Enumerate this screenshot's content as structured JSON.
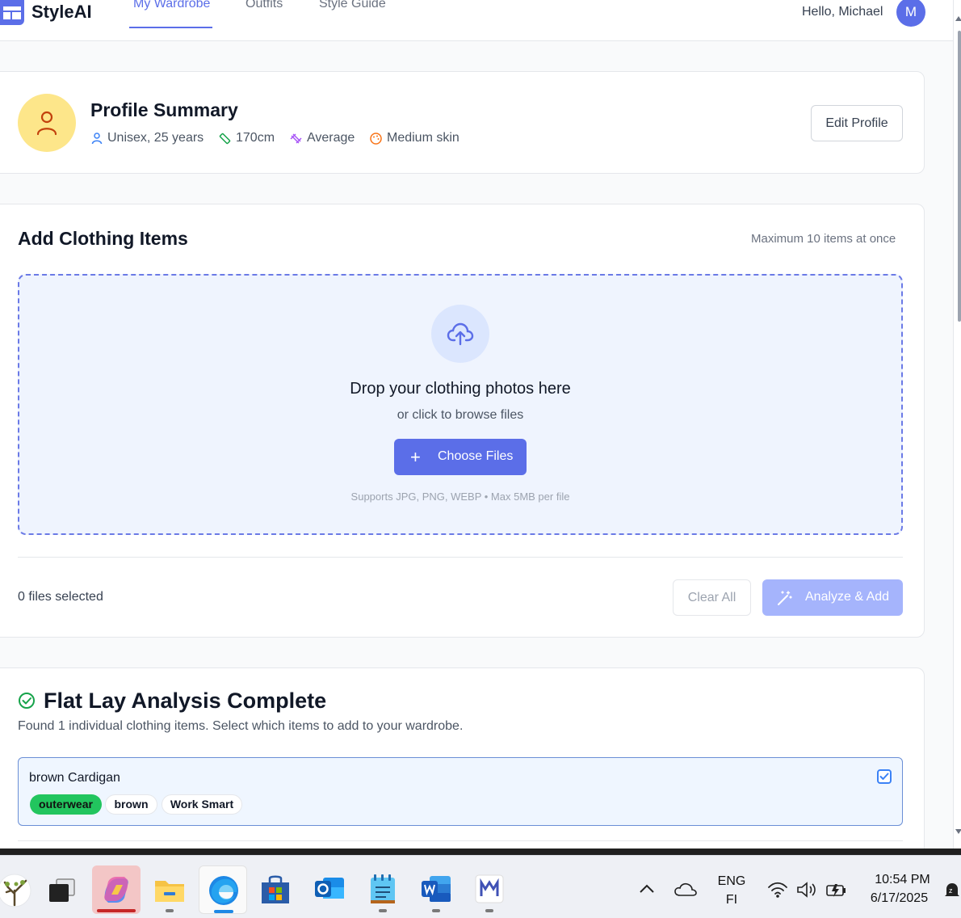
{
  "header": {
    "brand": "StyleAI",
    "tabs": [
      {
        "label": "My Wardrobe",
        "active": true
      },
      {
        "label": "Outfits",
        "active": false
      },
      {
        "label": "Style Guide",
        "active": false
      }
    ],
    "greeting": "Hello, Michael",
    "avatar_initial": "M"
  },
  "profile": {
    "title": "Profile Summary",
    "gender_age": "Unisex, 25 years",
    "height": "170cm",
    "build": "Average",
    "skin": "Medium skin",
    "edit_label": "Edit Profile"
  },
  "add_items": {
    "title": "Add Clothing Items",
    "max_note": "Maximum 10 items at once",
    "drop_title": "Drop your clothing photos here",
    "drop_sub": "or click to browse files",
    "choose_label": "Choose Files",
    "supports": "Supports JPG, PNG, WEBP • Max 5MB per file",
    "files_selected": "0 files selected",
    "clear_label": "Clear All",
    "analyze_label": "Analyze & Add"
  },
  "analysis": {
    "title": "Flat Lay Analysis Complete",
    "subtitle": "Found 1 individual clothing items. Select which items to add to your wardrobe.",
    "items": [
      {
        "name": "brown Cardigan",
        "selected": true,
        "tags": [
          "outerwear",
          "brown",
          "Work Smart"
        ]
      }
    ]
  },
  "taskbar": {
    "lang_top": "ENG",
    "lang_bottom": "FI",
    "time": "10:54 PM",
    "date": "6/17/2025"
  },
  "colors": {
    "accent": "#5b6ee8",
    "success": "#22c55e",
    "avatar_bg": "#fde68a"
  }
}
